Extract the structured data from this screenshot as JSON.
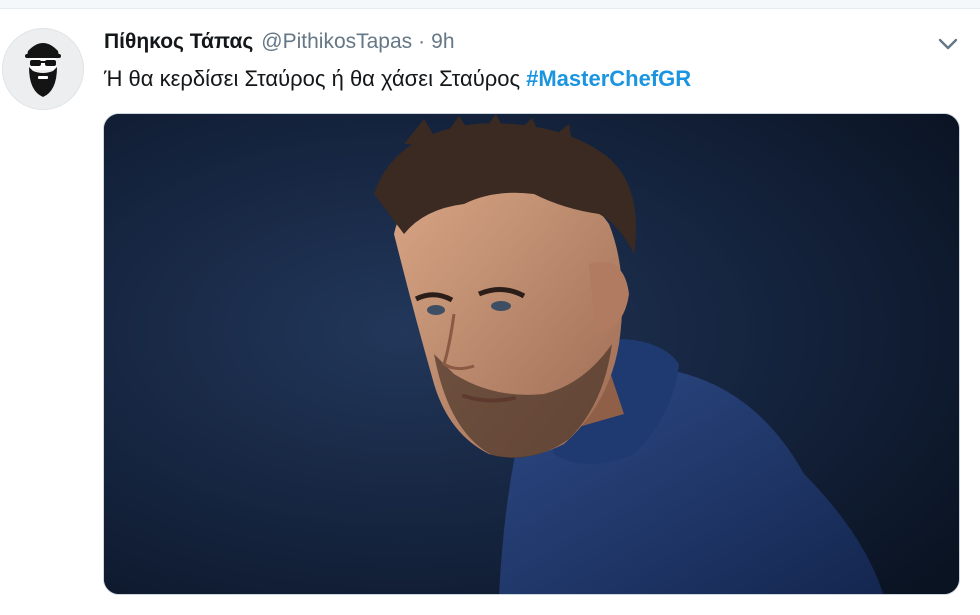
{
  "tweet": {
    "display_name": "Πίθηκος Τάπας",
    "handle": "@PithikosTapas",
    "separator": "·",
    "time": "9h",
    "text": "Ή θα κερδίσει Σταύρος ή θα χάσει Σταύρος",
    "hashtag": "#MasterChefGR"
  },
  "icons": {
    "avatar": "bearded-man-sunglasses-icon",
    "caret": "chevron-down-icon"
  },
  "colors": {
    "name": "#14171a",
    "secondary": "#657786",
    "hashtag": "#1b95e0",
    "photo_background": "#0e1a2e"
  }
}
